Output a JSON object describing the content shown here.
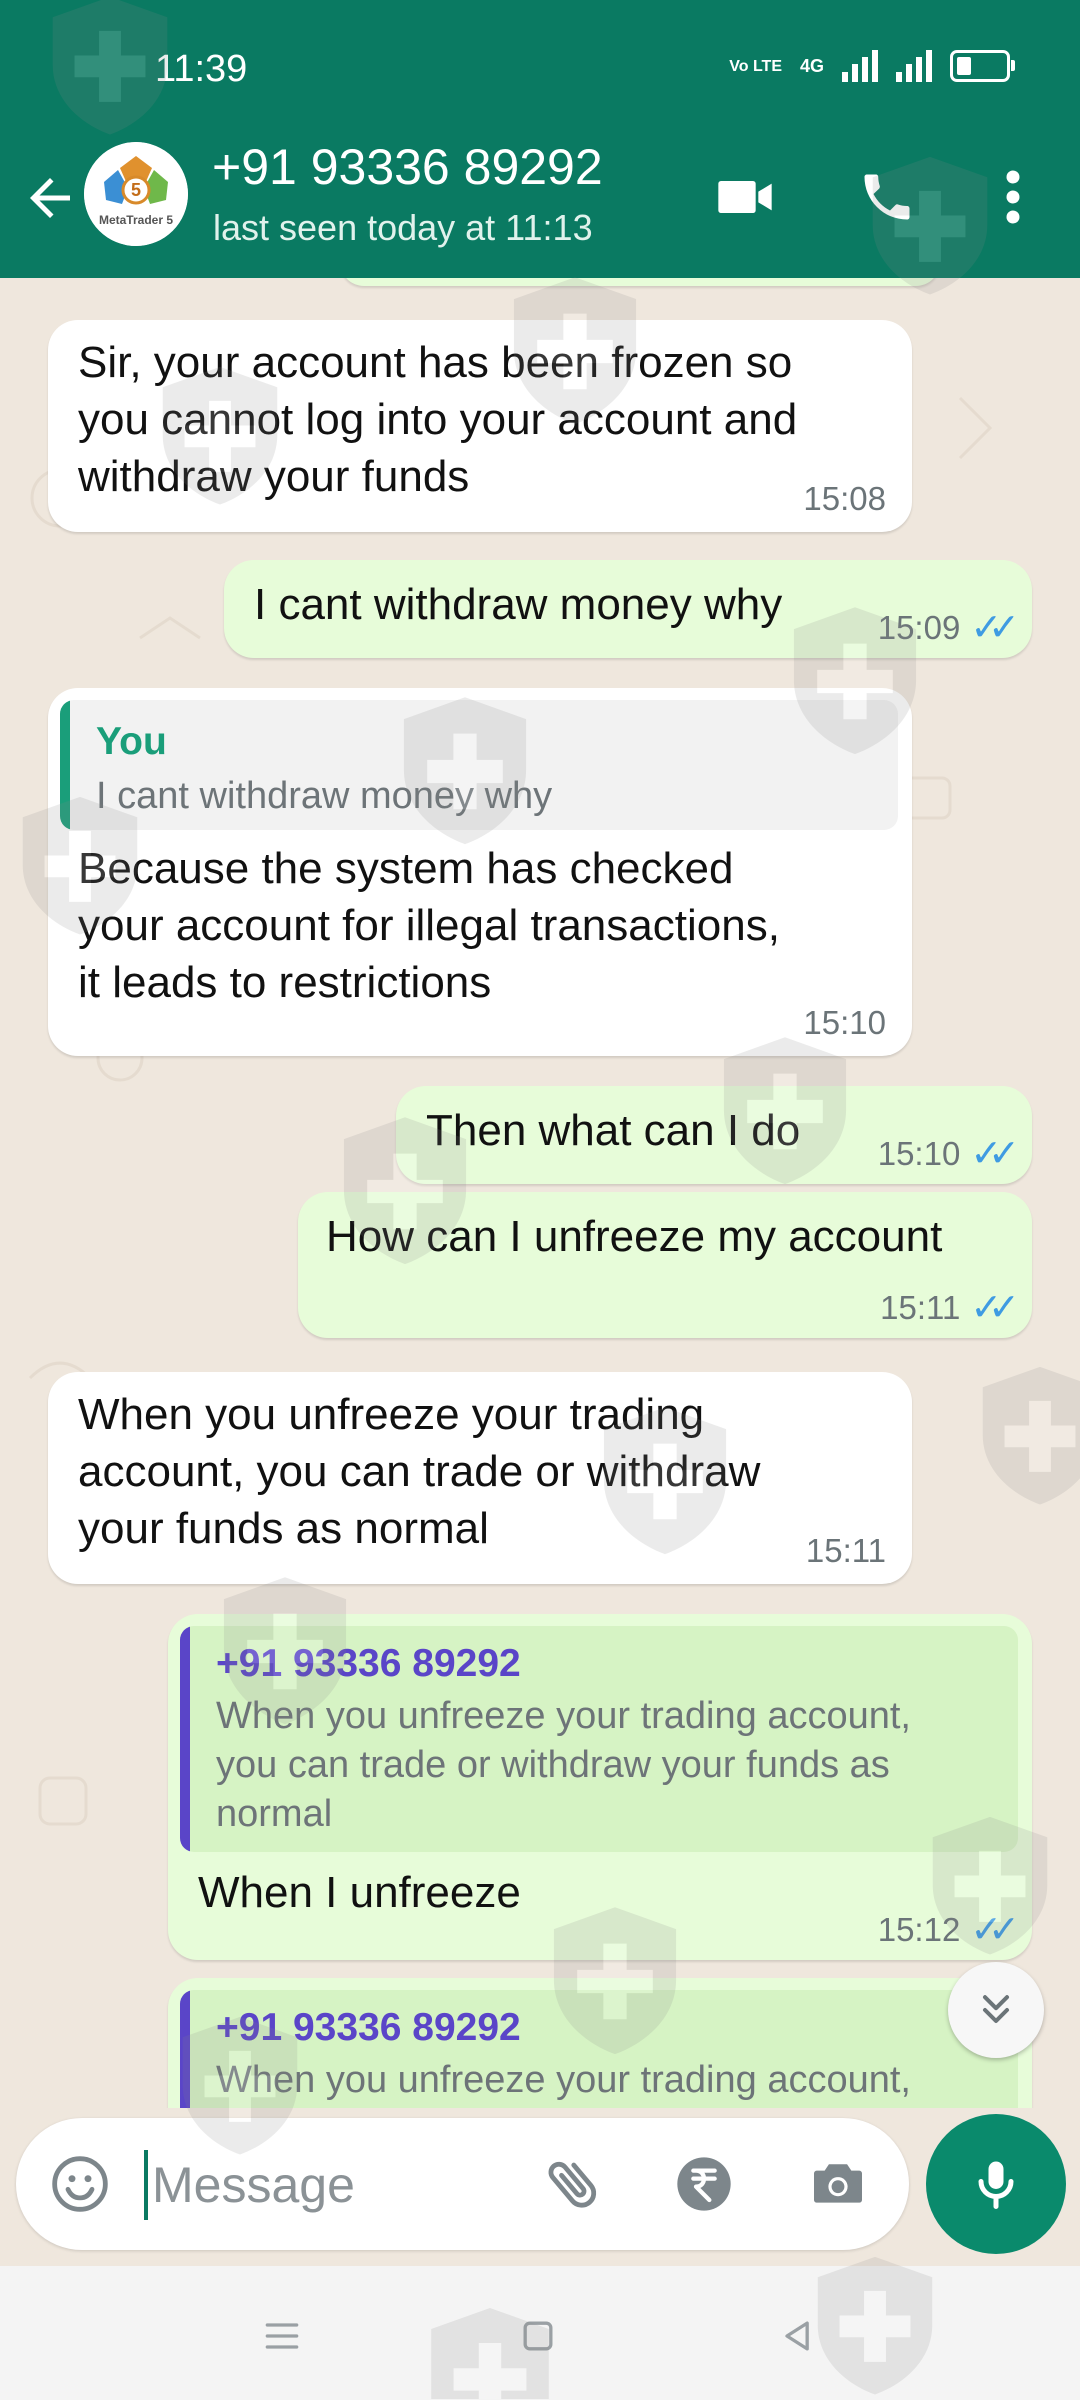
{
  "status_bar": {
    "time": "11:39",
    "volte": "Vo LTE",
    "network": "4G"
  },
  "header": {
    "title": "+91 93336 89292",
    "subtitle": "last seen today at 11:13",
    "avatar_label": "MetaTrader 5",
    "avatar_digit": "5",
    "icons": [
      "back-arrow-icon",
      "video-call-icon",
      "voice-call-icon",
      "more-vert-icon"
    ]
  },
  "messages": [
    {
      "direction": "in",
      "text_lines": [
        "Sir, your account has been frozen so",
        "you cannot log into your account and",
        "withdraw your funds"
      ],
      "time": "15:08"
    },
    {
      "direction": "out",
      "text": "I cant withdraw money why",
      "time": "15:09",
      "status": "read"
    },
    {
      "direction": "in",
      "quote": {
        "author": "You",
        "text": "I cant withdraw money why"
      },
      "text_lines": [
        "Because the system has checked",
        "your account for illegal transactions,",
        "it leads to restrictions"
      ],
      "time": "15:10"
    },
    {
      "direction": "out",
      "text": "Then what can I do",
      "time": "15:10",
      "status": "read"
    },
    {
      "direction": "out",
      "text": "How can I unfreeze my account",
      "time": "15:11",
      "status": "read"
    },
    {
      "direction": "in",
      "text_lines": [
        "When you unfreeze your trading",
        "account, you can trade or withdraw",
        "your funds as normal"
      ],
      "time": "15:11"
    },
    {
      "direction": "out",
      "quote": {
        "author": "+91 93336 89292",
        "text_lines": [
          "When you unfreeze your trading account,",
          "you can trade or withdraw your funds as",
          "normal"
        ]
      },
      "text": "When I unfreeze",
      "time": "15:12",
      "status": "read"
    },
    {
      "direction": "out",
      "quote": {
        "author": "+91 93336 89292",
        "text_lines": [
          "When you unfreeze your trading account,"
        ]
      }
    }
  ],
  "input": {
    "placeholder": "Message"
  },
  "colors": {
    "brand": "#0a7a62",
    "outgoing_bubble": "#e7fcd9",
    "incoming_bubble": "#ffffff",
    "chat_bg": "#efe7dd",
    "read_ticks": "#3f9be2",
    "quote_author_self": "#1a9e7a",
    "quote_author_contact": "#5a45c8"
  },
  "input_icons": [
    "emoji-icon",
    "attach-icon",
    "rupee-payment-icon",
    "camera-icon",
    "mic-icon"
  ],
  "nav_icons": [
    "menu-icon",
    "home-icon",
    "back-icon"
  ]
}
